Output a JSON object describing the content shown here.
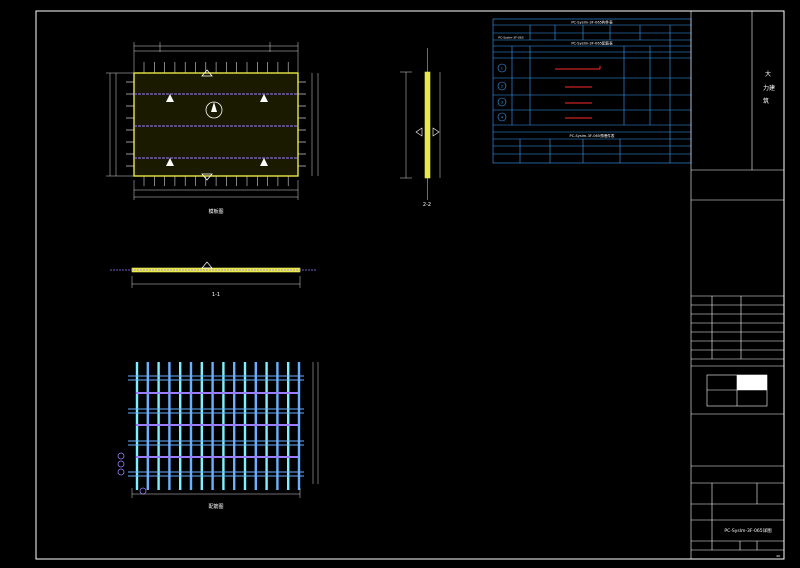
{
  "colors": {
    "background": "#000000",
    "frame": "#ffffff",
    "panel_fill": "#e8e84a",
    "table_line": "#3aa0ff",
    "rebar_blue": "#6ab0ff",
    "rebar_cyan": "#7ff0ff",
    "rebar_purple": "#9a7cff",
    "rebar_red": "#ff2a2a",
    "dim_line": "#d8d8d8"
  },
  "title_block": {
    "company_chars": [
      "大",
      "力",
      "建",
      "筑"
    ],
    "drawing_title": "PC-Syslm-3F-065详图",
    "sheet_number": "46"
  },
  "views": {
    "front_label": "模板图",
    "side_label": "2-2",
    "section_label": "1-1",
    "rebar_label": "配筋图"
  },
  "tables": {
    "t1_title": "PC-Syslm-3F-065构件表",
    "t1_row_label": "PC-Syslm-3F-065",
    "t2_title": "PC-Syslm-3F-065配筋表",
    "t3_title": "PC-Syslm-3F-065预埋件表",
    "rebar_ids": [
      "1",
      "2",
      "3",
      "4"
    ]
  },
  "icons": {
    "north_arrow": "north-arrow-icon",
    "lifting_point": "triangle-marker-icon"
  }
}
